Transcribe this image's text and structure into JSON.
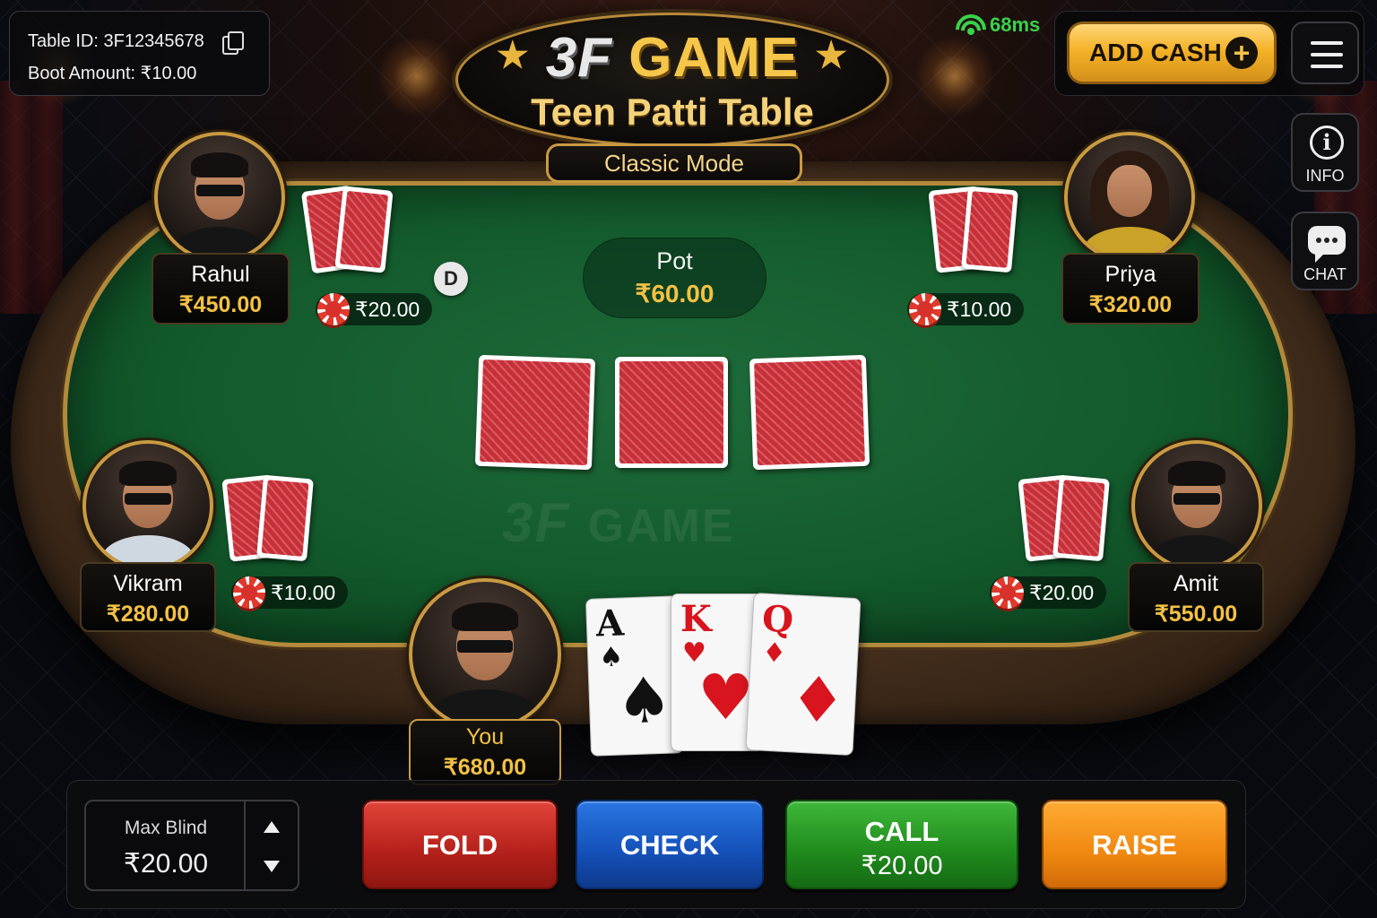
{
  "table_info": {
    "table_id": "Table ID: 3F12345678",
    "boot_amount": "Boot Amount: ₹10.00"
  },
  "header": {
    "logo_3f": "3F",
    "logo_game": "GAME",
    "title": "Teen Patti Table",
    "mode": "Classic Mode"
  },
  "network": {
    "ping": "68ms"
  },
  "actions": {
    "add_cash": "ADD CASH",
    "info": "INFO",
    "chat": "CHAT"
  },
  "pot": {
    "label": "Pot",
    "amount": "₹60.00"
  },
  "watermark": {
    "a": "3F",
    "b": "GAME"
  },
  "dealer": "D",
  "players": [
    {
      "name": "Rahul",
      "balance": "₹450.00",
      "bet": "₹20.00"
    },
    {
      "name": "Priya",
      "balance": "₹320.00",
      "bet": "₹10.00"
    },
    {
      "name": "Vikram",
      "balance": "₹280.00",
      "bet": "₹10.00"
    },
    {
      "name": "Amit",
      "balance": "₹550.00",
      "bet": "₹20.00"
    },
    {
      "name": "You",
      "balance": "₹680.00"
    }
  ],
  "my_cards": [
    {
      "rank": "A",
      "suit": "♠",
      "color": "#111111"
    },
    {
      "rank": "K",
      "suit": "♥",
      "color": "#d8141e"
    },
    {
      "rank": "Q",
      "suit": "♦",
      "color": "#d8141e"
    }
  ],
  "controls": {
    "blind_label": "Max Blind",
    "blind_value": "₹20.00",
    "fold": "FOLD",
    "check": "CHECK",
    "call": "CALL",
    "call_amount": "₹20.00",
    "raise": "RAISE"
  },
  "colors": {
    "gold": "#f3c144",
    "felt": "#135a2c",
    "signal": "#3ad14a"
  }
}
